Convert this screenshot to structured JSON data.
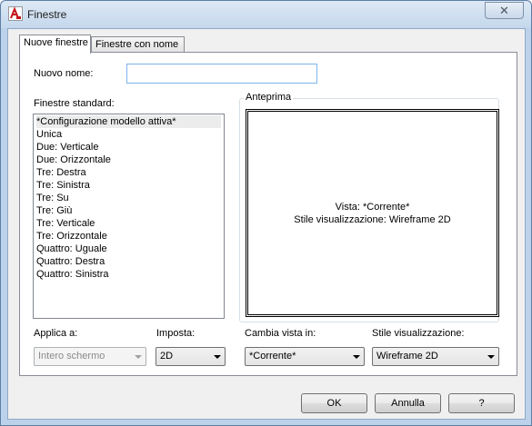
{
  "window": {
    "title": "Finestre"
  },
  "tabs": [
    {
      "label": "Nuove finestre",
      "active": true
    },
    {
      "label": "Finestre con nome",
      "active": false
    }
  ],
  "new_name": {
    "label": "Nuovo nome:",
    "value": ""
  },
  "standard": {
    "label": "Finestre standard:",
    "items": [
      "*Configurazione modello attiva*",
      "Unica",
      "Due: Verticale",
      "Due: Orizzontale",
      "Tre: Destra",
      "Tre: Sinistra",
      "Tre: Su",
      "Tre: Giù",
      "Tre: Verticale",
      "Tre: Orizzontale",
      "Quattro: Uguale",
      "Quattro: Destra",
      "Quattro: Sinistra"
    ],
    "selected_index": 0
  },
  "preview": {
    "label": "Anteprima",
    "line1": "Vista: *Corrente*",
    "line2": "Stile visualizzazione: Wireframe 2D"
  },
  "apply_to": {
    "label": "Applica a:",
    "value": "Intero schermo",
    "enabled": false
  },
  "setup": {
    "label": "Imposta:",
    "value": "2D"
  },
  "change_view": {
    "label": "Cambia vista in:",
    "value": "*Corrente*"
  },
  "visual_style": {
    "label": "Stile visualizzazione:",
    "value": "Wireframe 2D"
  },
  "buttons": {
    "ok": "OK",
    "cancel": "Annulla",
    "help": "?"
  },
  "icons": {
    "app": "autocad-icon",
    "close": "close-icon"
  }
}
